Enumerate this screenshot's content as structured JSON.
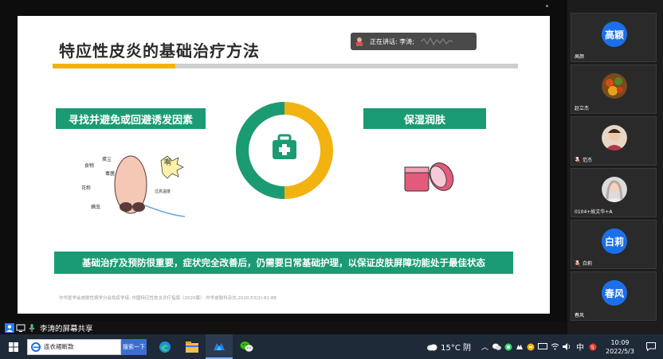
{
  "slide": {
    "title": "特应性皮炎的基础治疗方法",
    "speaker_label": "正在讲话: 李涛;",
    "left_heading": "寻找并避免或回避诱发因素",
    "right_heading": "保湿润肤",
    "bottom_text": "基础治疗及预防很重要，症状完全改善后，仍需要日常基础护理，以保证皮肤屏障功能处于最佳状态",
    "footnote": "中华医学会皮肤性病学分会免疫学组. 中国特应性皮炎诊疗指南（2020版）.中华皮肤科杂志,2020,53(2):81-88",
    "cartoon_words": [
      "食物",
      "蛋尘",
      "毒菌",
      "花粉",
      "螨虫",
      "啊",
      "过高温度"
    ],
    "colors": {
      "green": "#1a9b74",
      "yellow": "#f2b20f",
      "title_bar_gray": "#cfcfcf"
    }
  },
  "participants": [
    {
      "avatar_text": "高颖",
      "name": "高颜",
      "avatar": "text"
    },
    {
      "avatar_text": "",
      "name": "赵立杰",
      "avatar": "photo-food"
    },
    {
      "avatar_text": "",
      "name": "范杰",
      "avatar": "photo-person",
      "mic": true
    },
    {
      "avatar_text": "",
      "name": "0104+故文华+A",
      "avatar": "photo-girl"
    },
    {
      "avatar_text": "白莉",
      "name": "白莉",
      "avatar": "text",
      "mic": true
    },
    {
      "avatar_text": "春风",
      "name": "春风",
      "avatar": "text"
    }
  ],
  "share_bar": {
    "label": "李涛的屏幕共享"
  },
  "taskbar": {
    "search_query": "连衣裙断款",
    "search_button": "搜索一下",
    "weather": "15°C 阴",
    "ime": "中",
    "time": "10:09",
    "date": "2022/5/3",
    "apps": [
      "edge-icon",
      "file-explorer-icon",
      "tencent-meeting-icon",
      "wechat-icon"
    ]
  }
}
